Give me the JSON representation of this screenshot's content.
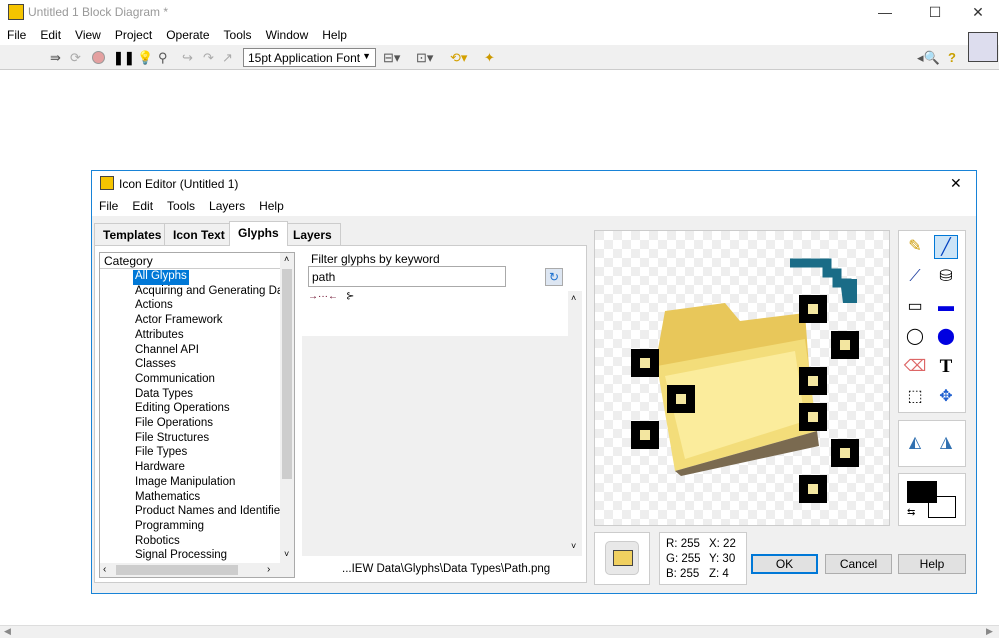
{
  "window": {
    "title": "Untitled 1 Block Diagram *",
    "controls": [
      "minimize",
      "maximize",
      "close"
    ]
  },
  "menu": [
    "File",
    "Edit",
    "View",
    "Project",
    "Operate",
    "Tools",
    "Window",
    "Help"
  ],
  "toolbar": {
    "font": "15pt Application Font",
    "icons": [
      "run-icon",
      "run-continuously-icon",
      "abort-icon",
      "pause-icon",
      "highlight-execution-icon",
      "retain-wire-values-icon",
      "step-into-icon",
      "step-over-icon",
      "step-out-icon",
      "align-icon",
      "distribute-icon",
      "reorder-icon",
      "cleanup-icon",
      "search-icon",
      "help-icon"
    ]
  },
  "dialog": {
    "title": "Icon Editor (Untitled 1)",
    "menu": [
      "File",
      "Edit",
      "Tools",
      "Layers",
      "Help"
    ],
    "tabs": [
      "Templates",
      "Icon Text",
      "Glyphs",
      "Layers"
    ],
    "active_tab": "Glyphs",
    "category_header": "Category",
    "categories": [
      "All Glyphs",
      "Acquiring and Generating Dat",
      "Actions",
      "Actor Framework",
      "Attributes",
      "Channel API",
      "Classes",
      "Communication",
      "Data Types",
      "Editing Operations",
      "File Operations",
      "File Structures",
      "File Types",
      "Hardware",
      "Image Manipulation",
      "Mathematics",
      "Product Names and Identifiers",
      "Programming",
      "Robotics",
      "Signal Processing"
    ],
    "selected_category": "All Glyphs",
    "filter_label": "Filter glyphs by keyword",
    "filter_value": "path",
    "glyph_path": "...IEW Data\\Glyphs\\Data Types\\Path.png",
    "pixel_info": {
      "r": "R: 255",
      "g": "G: 255",
      "b": "B: 255",
      "x": "X: 22",
      "y": "Y: 30",
      "z": "Z: 4"
    },
    "buttons": {
      "ok": "OK",
      "cancel": "Cancel",
      "help": "Help"
    },
    "tools": [
      "pencil",
      "line",
      "dropper",
      "fill",
      "rectangle",
      "filled-rectangle",
      "ellipse",
      "filled-ellipse",
      "eraser",
      "text",
      "select",
      "move",
      "flip-horizontal",
      "rotate"
    ],
    "colors": {
      "foreground": "#000000",
      "background": "#ffffff",
      "accent": "#0078d7"
    }
  }
}
